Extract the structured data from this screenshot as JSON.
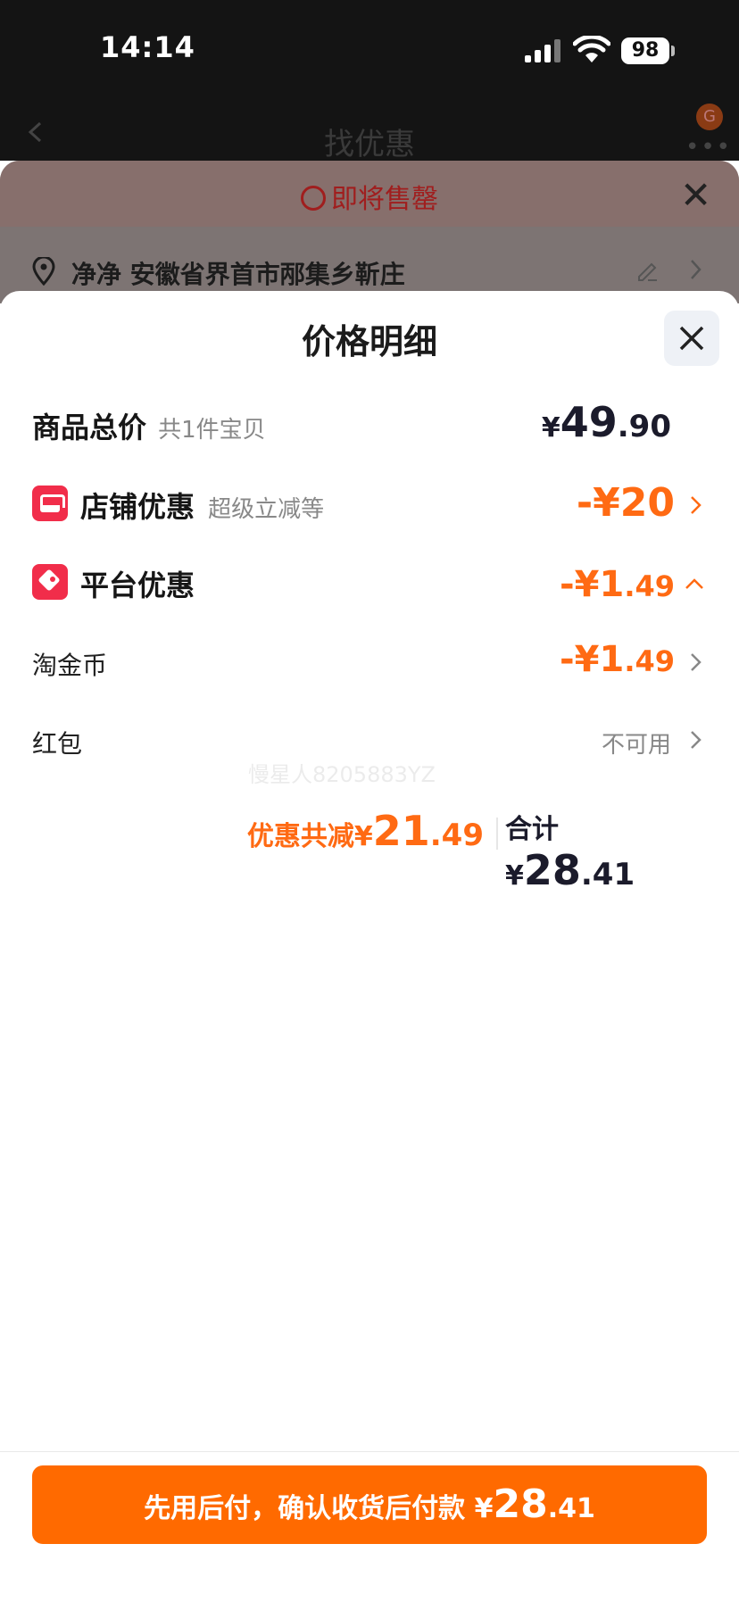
{
  "status_bar": {
    "time": "14:14",
    "battery": "98"
  },
  "header": {
    "title": "找优惠",
    "badge": "G"
  },
  "underlying": {
    "notice": "即将售罄",
    "address": "净净 安徽省界首市邴集乡靳庄"
  },
  "sheet": {
    "title": "价格明细",
    "total": {
      "label": "商品总价",
      "sub": "共1件宝贝",
      "yen": "¥",
      "int": "49",
      "dec": ".90"
    },
    "shop_discount": {
      "label": "店铺优惠",
      "sub": "超级立减等",
      "amount": "-¥20"
    },
    "platform_discount": {
      "label": "平台优惠",
      "amount_int": "-¥1",
      "amount_dec": ".49"
    },
    "coins": {
      "label": "淘金币",
      "amount_int": "-¥1",
      "amount_dec": ".49"
    },
    "red_packet": {
      "label": "红包",
      "value": "不可用"
    },
    "watermark": "慢星人8205883YZ",
    "summary": {
      "discount_label": "优惠共减¥",
      "discount_int": "21",
      "discount_dec": ".49",
      "total_label": "合计¥",
      "total_int": "28",
      "total_dec": ".41"
    }
  },
  "pay_button": {
    "text": "先用后付，确认收货后付款 ¥",
    "int": "28",
    "dec": ".41"
  },
  "colors": {
    "accent": "#ff6a00",
    "discount": "#ff6a13",
    "icon_red": "#f12d4a"
  }
}
